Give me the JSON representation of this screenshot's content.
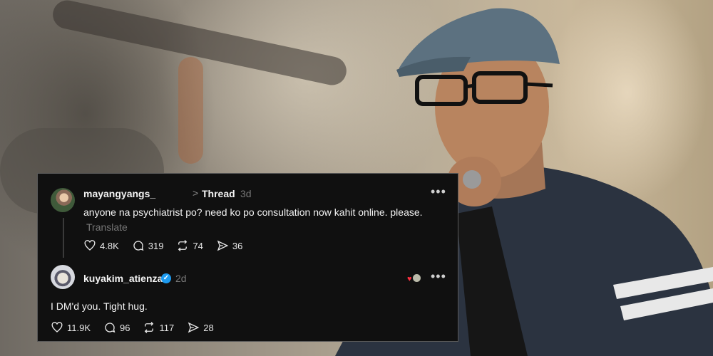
{
  "post": {
    "username": "mayangyangs_",
    "chevron": ">",
    "thread_label": "Thread",
    "time": "3d",
    "text": "anyone na psychiatrist po? need ko po consultation now kahit online. please.",
    "translate_label": "Translate",
    "more": "•••",
    "stats": {
      "likes": "4.8K",
      "comments": "319",
      "reposts": "74",
      "shares": "36"
    }
  },
  "reply": {
    "username": "kuyakim_atienza",
    "verified_icon": "✓",
    "time": "2d",
    "text": "I DM'd you. Tight hug.",
    "more": "•••",
    "stats": {
      "likes": "11.9K",
      "comments": "96",
      "reposts": "117",
      "shares": "28"
    }
  },
  "colors": {
    "card_bg": "#101010",
    "text": "#f3f3f3",
    "muted": "#777777",
    "verified": "#1d9bf0",
    "like_heart": "#ff3040"
  },
  "icons": [
    "heart-icon",
    "comment-icon",
    "repost-icon",
    "share-icon",
    "verified-icon",
    "more-icon"
  ]
}
